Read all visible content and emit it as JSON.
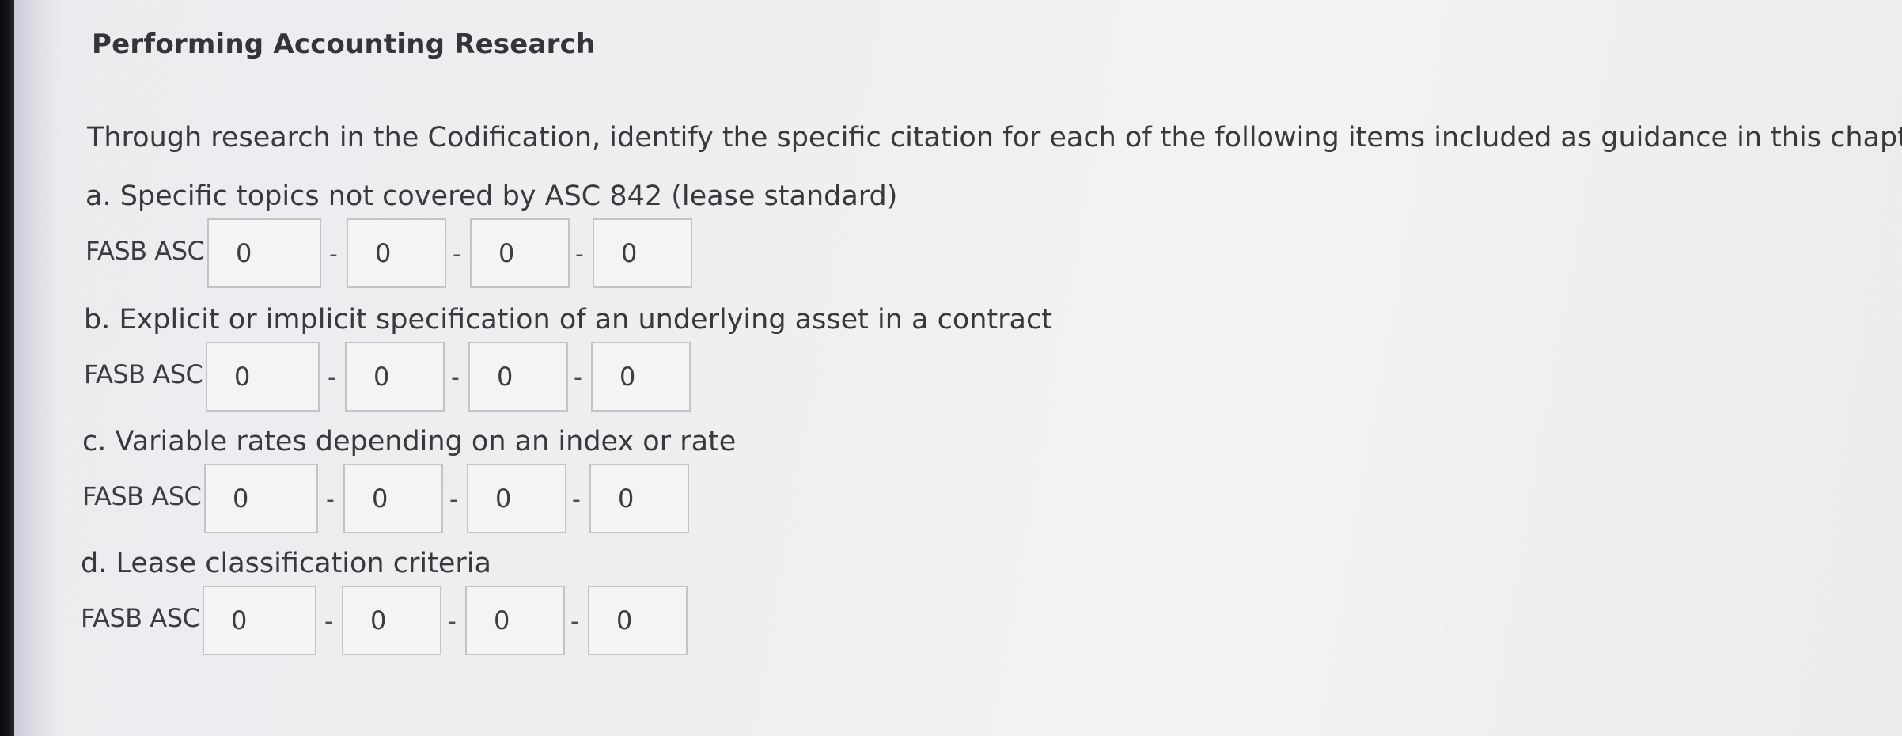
{
  "title": "Performing Accounting Research",
  "intro": "Through research in the Codification, identify the specific citation for each of the following items included as guidance in this chapter.",
  "prefix": "FASB ASC",
  "separator": "-",
  "items": [
    {
      "label": "a. Specific topics not covered by ASC 842 (lease standard)",
      "values": [
        "0",
        "0",
        "0",
        "0"
      ]
    },
    {
      "label": "b. Explicit or implicit specification of an underlying asset in a contract",
      "values": [
        "0",
        "0",
        "0",
        "0"
      ]
    },
    {
      "label": "c. Variable rates depending on an index or rate",
      "values": [
        "0",
        "0",
        "0",
        "0"
      ]
    },
    {
      "label": "d. Lease classification criteria",
      "values": [
        "0",
        "0",
        "0",
        "0"
      ]
    }
  ]
}
